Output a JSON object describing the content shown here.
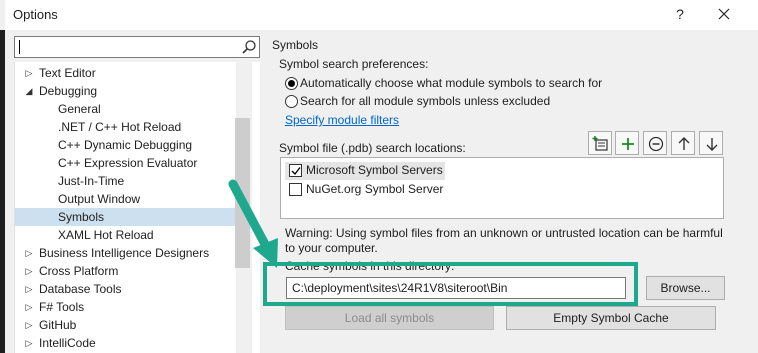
{
  "window": {
    "title": "Options",
    "help_label": "?"
  },
  "search": {
    "value": ""
  },
  "tree": {
    "items": [
      {
        "label": "Text Editor",
        "arrow": "▷",
        "indent": 0,
        "selected": false
      },
      {
        "label": "Debugging",
        "arrow": "◢",
        "indent": 0,
        "selected": false
      },
      {
        "label": "General",
        "indent": 1,
        "selected": false
      },
      {
        "label": ".NET / C++ Hot Reload",
        "indent": 1,
        "selected": false
      },
      {
        "label": "C++ Dynamic Debugging",
        "indent": 1,
        "selected": false
      },
      {
        "label": "C++ Expression Evaluator",
        "indent": 1,
        "selected": false
      },
      {
        "label": "Just-In-Time",
        "indent": 1,
        "selected": false
      },
      {
        "label": "Output Window",
        "indent": 1,
        "selected": false
      },
      {
        "label": "Symbols",
        "indent": 1,
        "selected": true
      },
      {
        "label": "XAML Hot Reload",
        "indent": 1,
        "selected": false
      },
      {
        "label": "Business Intelligence Designers",
        "arrow": "▷",
        "indent": 0,
        "selected": false
      },
      {
        "label": "Cross Platform",
        "arrow": "▷",
        "indent": 0,
        "selected": false
      },
      {
        "label": "Database Tools",
        "arrow": "▷",
        "indent": 0,
        "selected": false
      },
      {
        "label": "F# Tools",
        "arrow": "▷",
        "indent": 0,
        "selected": false
      },
      {
        "label": "GitHub",
        "arrow": "▷",
        "indent": 0,
        "selected": false
      },
      {
        "label": "IntelliCode",
        "arrow": "▷",
        "indent": 0,
        "selected": false
      }
    ]
  },
  "symbols": {
    "section_title": "Symbols",
    "prefs_label": "Symbol search preferences:",
    "radio_auto": "Automatically choose what module symbols to search for",
    "radio_all": "Search for all module symbols unless excluded",
    "filters_link": "Specify module filters",
    "locations_label": "Symbol file (.pdb) search locations:",
    "locations": [
      {
        "label": "Microsoft Symbol Servers",
        "checked": true
      },
      {
        "label": "NuGet.org Symbol Server",
        "checked": false
      }
    ],
    "warning": "Warning: Using symbol files from an unknown or untrusted location can be harmful to your computer.",
    "cache_label": "Cache symbols in this directory:",
    "cache_path": "C:\\deployment\\sites\\24R1V8\\siteroot\\Bin",
    "browse_label": "Browse...",
    "load_all_label": "Load all symbols",
    "empty_cache_label": "Empty Symbol Cache"
  },
  "colors": {
    "highlight": "#1fa88e",
    "link": "#0066cc",
    "selection": "#cce0ef"
  }
}
